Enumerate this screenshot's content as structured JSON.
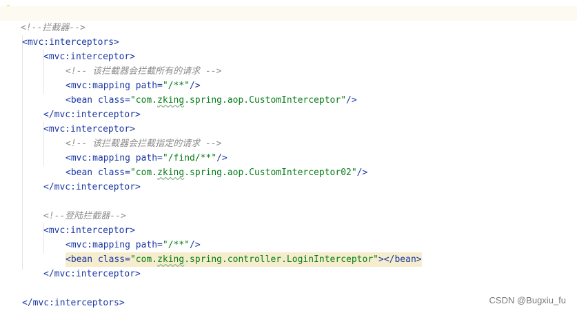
{
  "editor": {
    "lines": {
      "l1_comment": "<!--拦截器-->",
      "l2_open": "<mvc:interceptors>",
      "l3_open": "<mvc:interceptor>",
      "l4_comment": "<!-- 该拦截器会拦截所有的请求 -->",
      "l5_tag": "<mvc:mapping ",
      "l5_attr": "path=",
      "l5_val": "\"/**\"",
      "l5_end": "/>",
      "l6_tag": "<bean ",
      "l6_attr": "class=",
      "l6_val_a": "\"com.",
      "l6_val_ul": "zking",
      "l6_val_b": ".spring.aop.CustomInterceptor\"",
      "l6_end": "/>",
      "l7_close": "</mvc:interceptor>",
      "l8_open": "<mvc:interceptor>",
      "l9_comment": "<!-- 该拦截器会拦截指定的请求 -->",
      "l10_tag": "<mvc:mapping ",
      "l10_attr": "path=",
      "l10_val": "\"/find/**\"",
      "l10_end": "/>",
      "l11_tag": "<bean ",
      "l11_attr": "class=",
      "l11_val_a": "\"com.",
      "l11_val_ul": "zking",
      "l11_val_b": ".spring.aop.CustomInterceptor02\"",
      "l11_end": "/>",
      "l12_close": "</mvc:interceptor>",
      "l14_comment": "<!--登陆拦截器-->",
      "l15_open": "<mvc:interceptor>",
      "l16_tag": "<mvc:mapping ",
      "l16_attr": "path=",
      "l16_val": "\"/**\"",
      "l16_end": "/>",
      "l17_tag": "<bean ",
      "l17_attr": "class=",
      "l17_val_a": "\"com.",
      "l17_val_ul": "zking",
      "l17_val_b": ".spring.controller.LoginInterceptor\"",
      "l17_end": "></bean>",
      "l18_close": "</mvc:interceptor>",
      "l20_close": "</mvc:interceptors>"
    }
  },
  "watermark": "CSDN @Bugxiu_fu",
  "colors": {
    "tag": "#1a37a6",
    "string": "#067d17",
    "comment": "#8c8c8c",
    "highlight": "#f5edcd"
  }
}
